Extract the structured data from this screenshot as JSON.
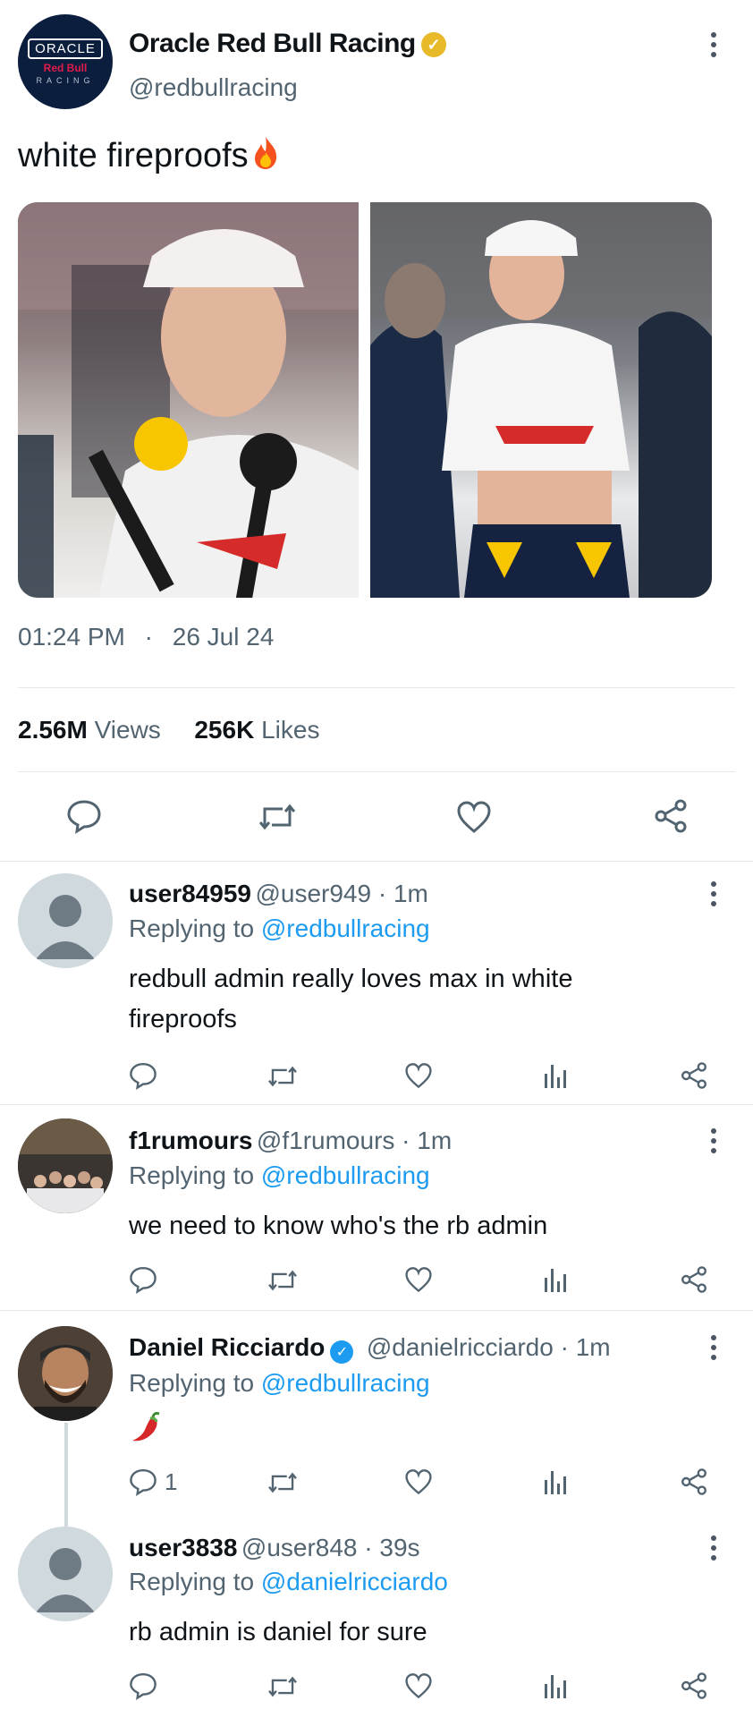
{
  "tweet": {
    "display_name": "Oracle Red Bull Racing",
    "handle": "@redbullracing",
    "text": "white fireproofs",
    "time": "01:24 PM",
    "separator": "·",
    "date": "26 Jul 24",
    "views_count": "2.56M",
    "views_label": "Views",
    "likes_count": "256K",
    "likes_label": "Likes"
  },
  "avatar_logo": {
    "line1": "ORACLE",
    "line2": "Red Bull",
    "line3": "RACING"
  },
  "replies": [
    {
      "display_name": "user84959",
      "meta": "@user949 · 1m",
      "replying_label": "Replying to",
      "replying_to": "@redbullracing",
      "text": "redbull admin really loves max in white fireproofs",
      "reply_count": ""
    },
    {
      "display_name": "f1rumours",
      "meta": "@f1rumours · 1m",
      "replying_label": "Replying to",
      "replying_to": "@redbullracing",
      "text": "we need to know who's the rb admin",
      "reply_count": ""
    },
    {
      "display_name": "Daniel Ricciardo",
      "meta": "@danielricciardo · 1m",
      "replying_label": "Replying to",
      "replying_to": "@redbullracing",
      "text": "",
      "reply_count": "1"
    },
    {
      "display_name": "user3838",
      "meta": "@user848 · 39s",
      "replying_label": "Replying to",
      "replying_to": "@danielricciardo",
      "text": "rb admin is daniel for sure",
      "reply_count": ""
    }
  ],
  "icons": {
    "reply": "reply-icon",
    "retweet": "retweet-icon",
    "like": "heart-icon",
    "views": "views-icon",
    "share": "share-icon",
    "more": "more-icon",
    "verified": "verified-icon",
    "fire": "fire-emoji-icon",
    "pepper": "chili-pepper-emoji-icon"
  },
  "colors": {
    "link": "#1d9bf0",
    "muted": "#536471",
    "gold_badge": "#e8b928",
    "blue_badge": "#1d9bf0"
  }
}
